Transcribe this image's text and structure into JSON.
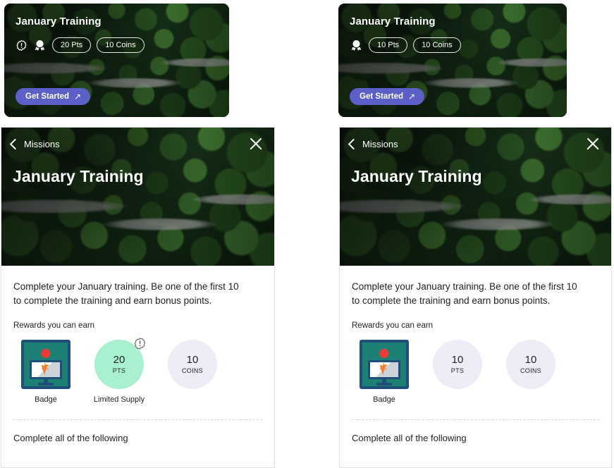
{
  "promo_cards": [
    {
      "title": "January Training",
      "icons": [
        {
          "name": "limited-supply-icon",
          "label": "Limited Supply"
        },
        {
          "name": "award-badge-icon",
          "label": "Badge"
        }
      ],
      "chips": [
        "20 Pts",
        "10 Coins"
      ],
      "cta": {
        "label": "Get Started",
        "arrow": "↗"
      }
    },
    {
      "title": "January Training",
      "icons": [
        {
          "name": "award-badge-icon",
          "label": "Badge"
        }
      ],
      "chips": [
        "10 Pts",
        "10 Coins"
      ],
      "cta": {
        "label": "Get Started",
        "arrow": "↗"
      }
    }
  ],
  "detail_panels": [
    {
      "back_label": "Missions",
      "title": "January Training",
      "description": "Complete your January training. Be one of the first 10 to complete the training and earn bonus points.",
      "rewards_label": "Rewards you can earn",
      "rewards": [
        {
          "kind": "badge",
          "caption": "Badge"
        },
        {
          "kind": "points",
          "value": "20",
          "unit": "PTS",
          "caption": "Limited Supply",
          "limited": true,
          "color": "#a8f0cf"
        },
        {
          "kind": "coins",
          "value": "10",
          "unit": "COINS",
          "caption": "",
          "limited": false,
          "color": "#eeedf7"
        }
      ],
      "complete_label": "Complete all of the following"
    },
    {
      "back_label": "Missions",
      "title": "January Training",
      "description": "Complete your January training. Be one of the first 10 to complete the training and earn bonus points.",
      "rewards_label": "Rewards you can earn",
      "rewards": [
        {
          "kind": "badge",
          "caption": "Badge"
        },
        {
          "kind": "points",
          "value": "10",
          "unit": "PTS",
          "caption": "",
          "limited": false,
          "color": "#eeedf7"
        },
        {
          "kind": "coins",
          "value": "10",
          "unit": "COINS",
          "caption": "",
          "limited": false,
          "color": "#eeedf7"
        }
      ],
      "complete_label": "Complete all of the following"
    }
  ],
  "colors": {
    "accent_purple": "#5b5fc7",
    "points_mint": "#a8f0cf",
    "coins_lavender": "#eeedf7",
    "badge_teal": "#1c8074",
    "badge_border_navy": "#1f4e79",
    "text_primary": "#242424"
  }
}
